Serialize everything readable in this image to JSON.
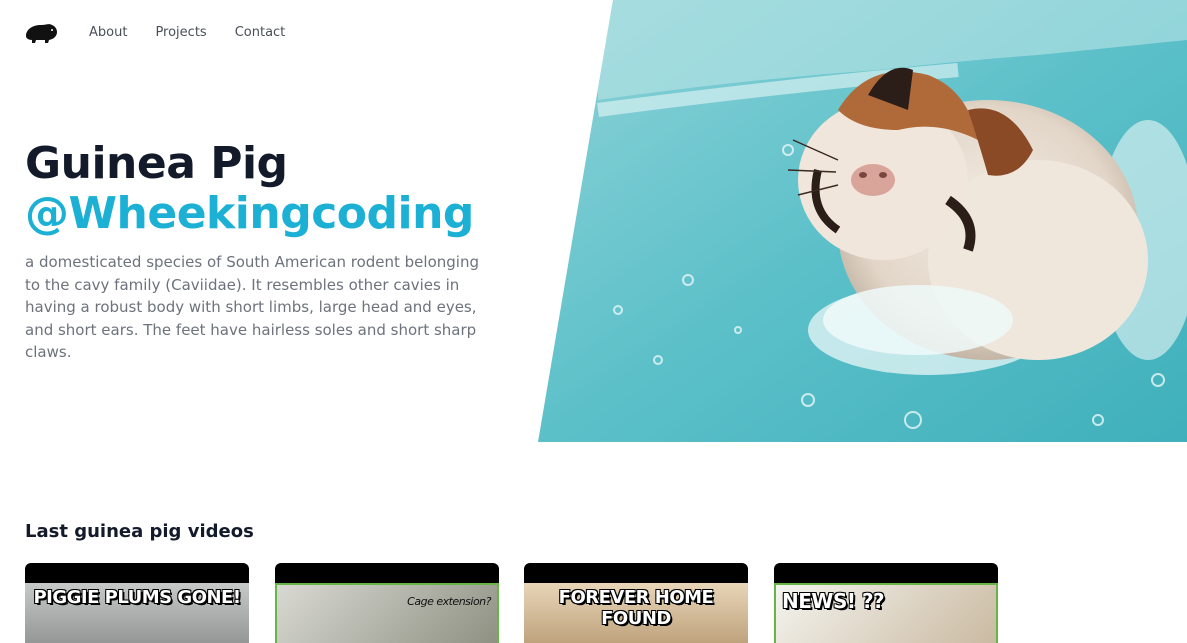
{
  "nav": {
    "logo_icon": "guinea-pig-silhouette-icon",
    "items": [
      "About",
      "Projects",
      "Contact"
    ]
  },
  "hero": {
    "title": "Guinea Pig",
    "subtitle": "@Wheekingcoding",
    "description": "a domesticated species of South American rodent belonging to the cavy family (Caviidae). It resembles other cavies in having a robust body with short limbs, large head and eyes, and short ears. The feet have hairless soles and short sharp claws.",
    "image": "wet-guinea-pig-in-bath-photo"
  },
  "videos": {
    "title": "Last guinea pig videos",
    "items": [
      {
        "thumb_text": "PIGGIE PLUMS GONE!"
      },
      {
        "thumb_text": "Cage extension?"
      },
      {
        "thumb_text": "FOREVER HOME FOUND"
      },
      {
        "thumb_text": "NEWS! ??"
      }
    ]
  },
  "colors": {
    "accent": "#1cb0d4",
    "heading": "#131a2a",
    "body_text": "#6d727c",
    "water": "#5fc3cc"
  }
}
